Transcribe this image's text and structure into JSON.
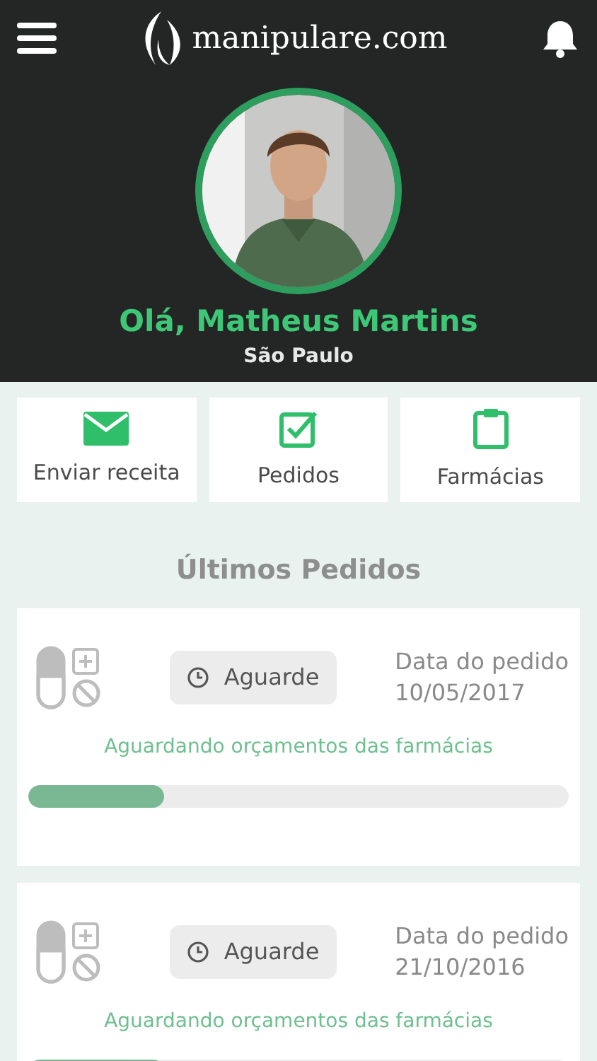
{
  "header": {
    "logo_text": "manipulare.com"
  },
  "profile": {
    "greeting": "Olá, Matheus Martins",
    "city": "São Paulo"
  },
  "actions": [
    {
      "kind": "mail",
      "label": "Enviar receita"
    },
    {
      "kind": "check",
      "label": "Pedidos"
    },
    {
      "kind": "clipboard",
      "label": "Farmácias"
    }
  ],
  "section_title": "Últimos Pedidos",
  "orders": [
    {
      "status": "Aguarde",
      "date_label": "Data do pedido",
      "date": "10/05/2017",
      "message": "Aguardando orçamentos das farmácias",
      "level": 0.25
    },
    {
      "status": "Aguarde",
      "date_label": "Data do pedido",
      "date": "21/10/2016",
      "message": "Aguardando orçamentos das farmácias",
      "level": 0.25
    }
  ]
}
